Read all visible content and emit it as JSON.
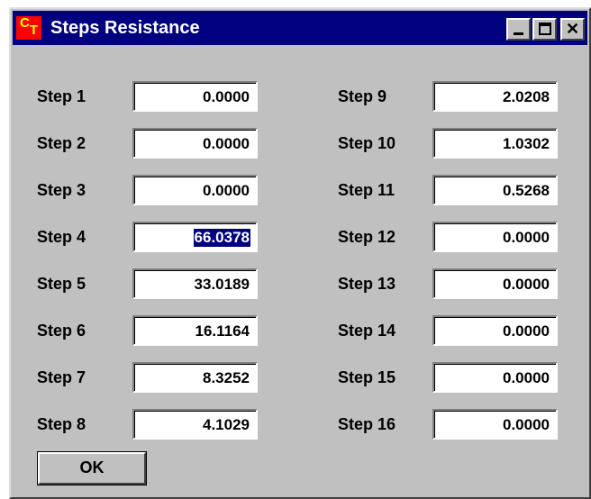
{
  "window": {
    "title": "Steps Resistance",
    "icon_top": "C",
    "icon_bottom": "T",
    "icon_name": "app-icon"
  },
  "controls": {
    "minimize": "minimize",
    "maximize": "maximize",
    "close": "close"
  },
  "steps_left": [
    {
      "label": "Step 1",
      "value": "0.0000"
    },
    {
      "label": "Step 2",
      "value": "0.0000"
    },
    {
      "label": "Step 3",
      "value": "0.0000"
    },
    {
      "label": "Step 4",
      "value": "66.0378"
    },
    {
      "label": "Step 5",
      "value": "33.0189"
    },
    {
      "label": "Step 6",
      "value": "16.1164"
    },
    {
      "label": "Step 7",
      "value": "8.3252"
    },
    {
      "label": "Step 8",
      "value": "4.1029"
    }
  ],
  "steps_right": [
    {
      "label": "Step 9",
      "value": "2.0208"
    },
    {
      "label": "Step 10",
      "value": "1.0302"
    },
    {
      "label": "Step 11",
      "value": "0.5268"
    },
    {
      "label": "Step 12",
      "value": "0.0000"
    },
    {
      "label": "Step 13",
      "value": "0.0000"
    },
    {
      "label": "Step 14",
      "value": "0.0000"
    },
    {
      "label": "Step 15",
      "value": "0.0000"
    },
    {
      "label": "Step 16",
      "value": "0.0000"
    }
  ],
  "selected_step": "Step 4",
  "ok_button": "OK",
  "colors": {
    "titlebar": "#000080",
    "dialog": "#c0c0c0",
    "selection": "#000080"
  }
}
